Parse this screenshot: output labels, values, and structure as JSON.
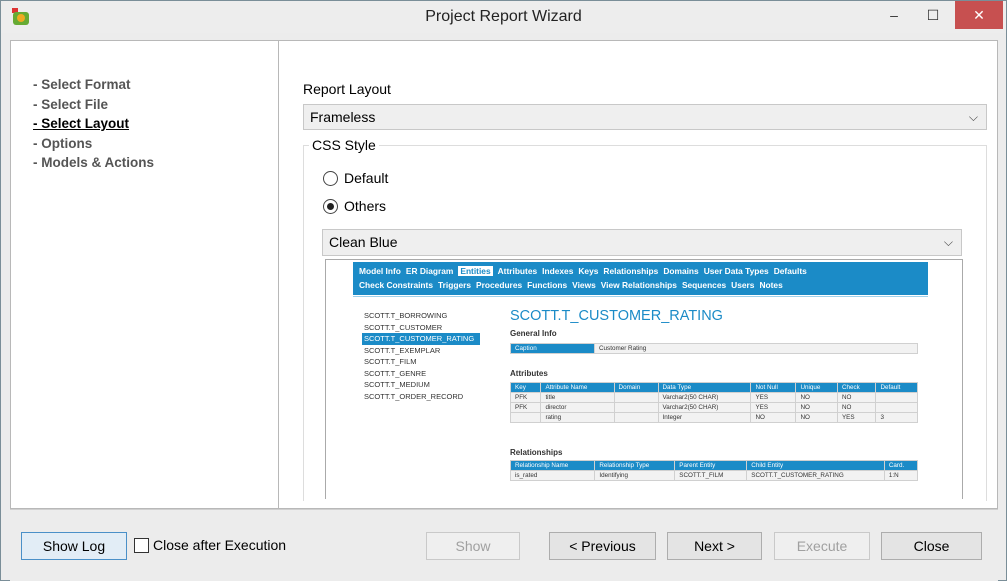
{
  "window": {
    "title": "Project Report Wizard",
    "min": "–",
    "max": "☐",
    "close": "✕"
  },
  "steps": [
    {
      "label": "- Select Format",
      "active": false
    },
    {
      "label": "- Select File",
      "active": false
    },
    {
      "label": "- Select Layout",
      "active": true
    },
    {
      "label": "- Options",
      "active": false
    },
    {
      "label": "- Models & Actions",
      "active": false
    }
  ],
  "layout": {
    "label": "Report Layout",
    "selected": "Frameless"
  },
  "css": {
    "legend": "CSS Style",
    "default_label": "Default",
    "others_label": "Others",
    "selected_radio": "Others",
    "style_selected": "Clean Blue"
  },
  "preview": {
    "nav_row1": [
      "Model Info",
      "ER Diagram",
      "Entities",
      "Attributes",
      "Indexes",
      "Keys",
      "Relationships",
      "Domains",
      "User Data Types",
      "Defaults"
    ],
    "nav_row2": [
      "Check Constraints",
      "Triggers",
      "Procedures",
      "Functions",
      "Views",
      "View Relationships",
      "Sequences",
      "Users",
      "Notes"
    ],
    "nav_selected": "Entities",
    "entities": [
      "SCOTT.T_BORROWING",
      "SCOTT.T_CUSTOMER",
      "SCOTT.T_CUSTOMER_RATING",
      "SCOTT.T_EXEMPLAR",
      "SCOTT.T_FILM",
      "SCOTT.T_GENRE",
      "SCOTT.T_MEDIUM",
      "SCOTT.T_ORDER_RECORD"
    ],
    "entity_selected": "SCOTT.T_CUSTOMER_RATING",
    "title": "SCOTT.T_CUSTOMER_RATING",
    "general_info": "General Info",
    "caption_key": "Caption",
    "caption_value": "Customer Rating",
    "attributes_heading": "Attributes",
    "attr_headers": [
      "Key",
      "Attribute Name",
      "Domain",
      "Data Type",
      "Not Null",
      "Unique",
      "Check",
      "Default"
    ],
    "attr_rows": [
      [
        "PFK",
        "title",
        "",
        "Varchar2(50 CHAR)",
        "YES",
        "NO",
        "NO",
        ""
      ],
      [
        "PFK",
        "director",
        "",
        "Varchar2(50 CHAR)",
        "YES",
        "NO",
        "NO",
        ""
      ],
      [
        "",
        "rating",
        "",
        "Integer",
        "NO",
        "NO",
        "YES",
        "3"
      ]
    ],
    "relationships_heading": "Relationships",
    "rel_headers": [
      "Relationship Name",
      "Relationship Type",
      "Parent Entity",
      "Child Entity",
      "Card."
    ],
    "rel_rows": [
      [
        "is_rated",
        "Identifying",
        "SCOTT.T_FILM",
        "SCOTT.T_CUSTOMER_RATING",
        "1:N"
      ]
    ]
  },
  "footer": {
    "show_log": "Show Log",
    "close_after": "Close after Execution",
    "show": "Show",
    "previous": "< Previous",
    "next": "Next >",
    "execute": "Execute",
    "close": "Close"
  }
}
